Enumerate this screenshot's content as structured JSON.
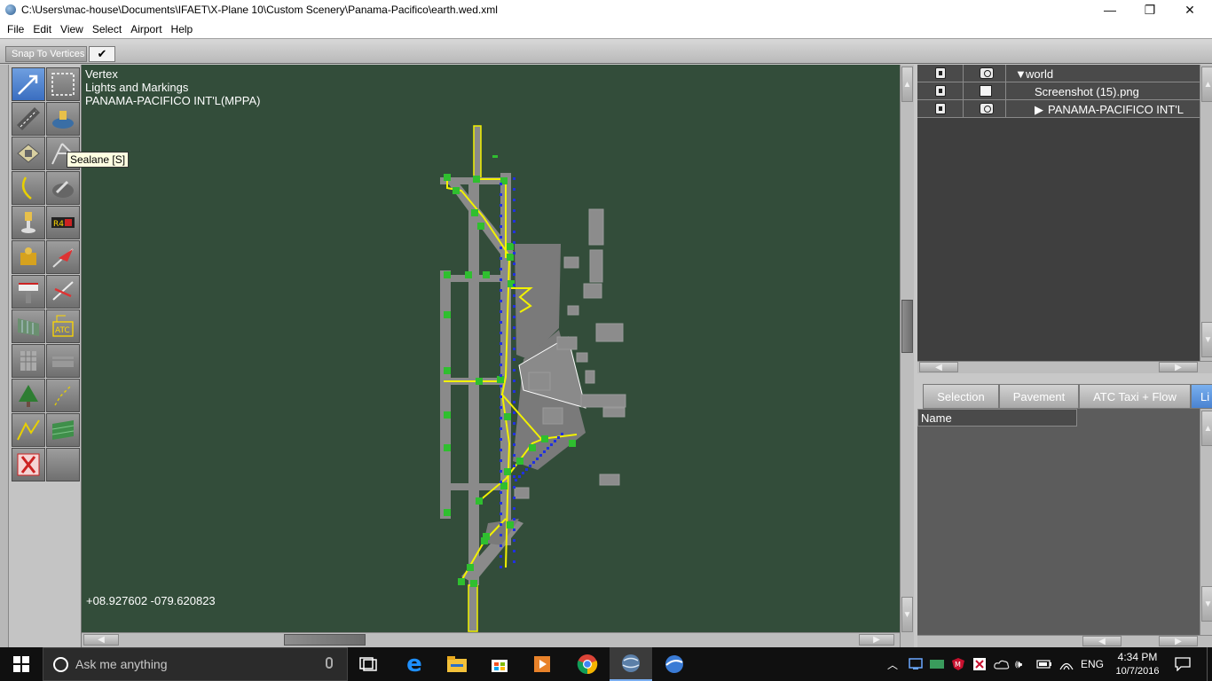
{
  "window": {
    "title": "C:\\Users\\mac-house\\Documents\\IFAET\\X-Plane 10\\Custom Scenery\\Panama-Pacifico\\earth.wed.xml",
    "minimize": "—",
    "restore": "❐",
    "close": "✕"
  },
  "menu": [
    "File",
    "Edit",
    "View",
    "Select",
    "Airport",
    "Help"
  ],
  "snapbar": {
    "label": "Snap To Vertices",
    "checked": "✔"
  },
  "tools": [
    {
      "name": "vertex-tool-icon",
      "active": true
    },
    {
      "name": "marquee-tool-icon",
      "active": false
    },
    {
      "name": "runway-tool-icon",
      "active": false
    },
    {
      "name": "helipad-tool-icon",
      "active": false
    },
    {
      "name": "taxiway-tool-icon",
      "active": false
    },
    {
      "name": "sealane-tool-icon",
      "active": false
    },
    {
      "name": "taxiline-tool-icon",
      "active": false
    },
    {
      "name": "boundary-tool-icon",
      "active": false
    },
    {
      "name": "light-tool-icon",
      "active": false
    },
    {
      "name": "sign-tool-icon",
      "active": false
    },
    {
      "name": "beacon-tool-icon",
      "active": false
    },
    {
      "name": "windsock-tool-icon",
      "active": false
    },
    {
      "name": "tower-viewpoint-tool-icon",
      "active": false
    },
    {
      "name": "ramp-start-tool-icon",
      "active": false
    },
    {
      "name": "facade-tool-icon",
      "active": false
    },
    {
      "name": "atc-flow-tool-icon",
      "active": false
    },
    {
      "name": "object-tool-icon",
      "active": false
    },
    {
      "name": "string-tool-icon",
      "active": false
    },
    {
      "name": "forest-tool-icon",
      "active": false
    },
    {
      "name": "line-tool-icon",
      "active": false
    },
    {
      "name": "polygon-line-tool-icon",
      "active": false
    },
    {
      "name": "draped-polygon-tool-icon",
      "active": false
    },
    {
      "name": "exclusion-tool-icon",
      "active": false
    },
    {
      "name": "empty-tool-icon",
      "active": false
    }
  ],
  "tooltip": "Sealane [S]",
  "map": {
    "tool_name": "Vertex",
    "layer_name": "Lights and Markings",
    "airport": "PANAMA-PACIFICO INT'L(MPPA)",
    "coords": "+08.927602 -079.620823"
  },
  "layers": [
    {
      "name": "world",
      "prefix": "▼",
      "lock": true,
      "visible": "eye"
    },
    {
      "name": "Screenshot (15).png",
      "prefix": "",
      "lock": true,
      "visible": "box"
    },
    {
      "name": "PANAMA-PACIFICO INT'L",
      "prefix": "▶",
      "lock": true,
      "visible": "eye"
    }
  ],
  "tabs": [
    "Selection",
    "Pavement",
    "ATC Taxi + Flow",
    "Li"
  ],
  "props": {
    "header": "Name"
  },
  "taskbar": {
    "search_placeholder": "Ask me anything",
    "lang": "ENG",
    "time": "4:34 PM",
    "date": "10/7/2016"
  },
  "colors": {
    "map_bg": "#334d3a",
    "runway": "#8a8a8a",
    "taxi_line": "#f2f200",
    "node": "#2fbf2f",
    "light": "#2030e0",
    "active_tool": "#4a83d1"
  }
}
